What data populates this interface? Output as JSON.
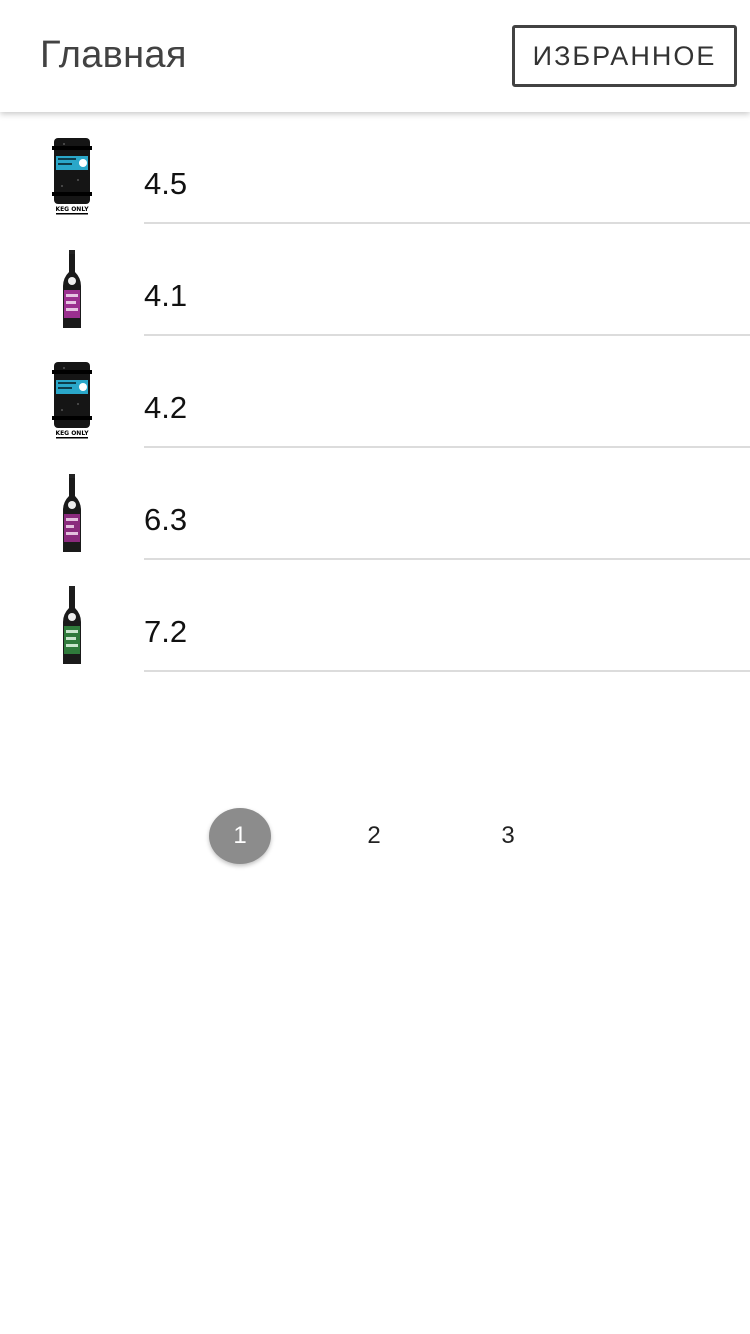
{
  "header": {
    "title": "Главная",
    "favorites_label": "ИЗБРАННОЕ"
  },
  "items": [
    {
      "value": "4.5",
      "image": "keg-icon",
      "accent": "#2aa7c9",
      "keg_label": "KEG ONLY"
    },
    {
      "value": "4.1",
      "image": "bottle-icon",
      "accent": "#9b2f8f"
    },
    {
      "value": "4.2",
      "image": "keg-icon",
      "accent": "#2aa7c9",
      "keg_label": "KEG ONLY"
    },
    {
      "value": "6.3",
      "image": "bottle-icon",
      "accent": "#8a2a7d"
    },
    {
      "value": "7.2",
      "image": "bottle-icon",
      "accent": "#2f7a3b"
    }
  ],
  "pagination": {
    "pages": [
      "1",
      "2",
      "3"
    ],
    "current": "1"
  },
  "colors": {
    "active_page_bg": "#8c8c8c",
    "divider": "#dcdcdc",
    "title": "#424242"
  }
}
